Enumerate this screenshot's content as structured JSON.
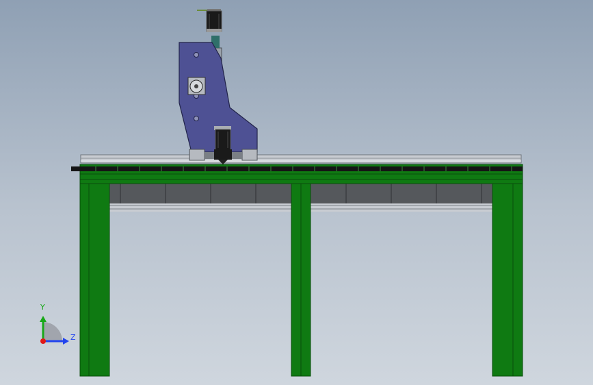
{
  "viewport": {
    "background_top": "#8fa0b4",
    "background_bottom": "#cfd6de"
  },
  "model": {
    "frame_color": "#0f7a12",
    "frame_dark": "#0a4d0c",
    "gantry_plate_color": "#4e5194",
    "motor_color": "#1a1a1a",
    "rail_color": "#c8ccd2",
    "infill_color": "#55585c"
  },
  "triad": {
    "y_label": "Y",
    "z_label": "Z",
    "y_color": "#18a818",
    "z_color": "#2244ee",
    "x_color": "#e01818"
  }
}
